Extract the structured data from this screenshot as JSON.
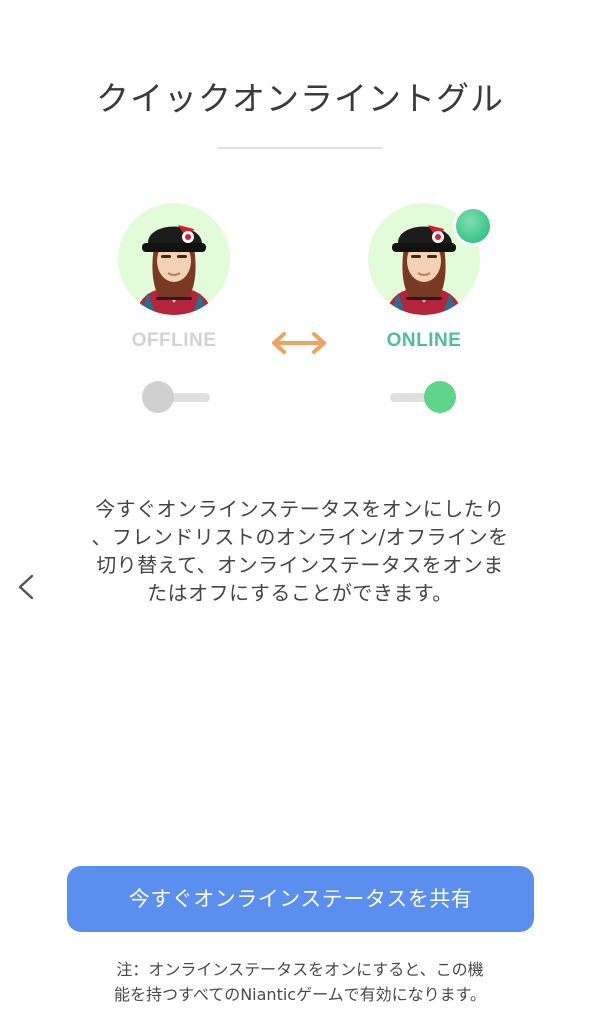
{
  "title": "クイックオンライントグル",
  "offline_card": {
    "label": "OFFLINE",
    "avatar_icon": "trainer-avatar-icon",
    "toggle_state": "off"
  },
  "online_card": {
    "label": "ONLINE",
    "avatar_icon": "trainer-avatar-icon",
    "toggle_state": "on",
    "status_dot_color": "#3ac48a"
  },
  "swap_icon": "double-arrow-icon",
  "back_icon": "chevron-left-icon",
  "description": "今すぐオンラインステータスをオンにしたり\n、フレンドリストのオンライン/オフラインを\n切り替えて、オンラインステータスをオンま\nたはオフにすることができます。",
  "share_button": {
    "label": "今すぐオンラインステータスを共有"
  },
  "note": "注：オンラインステータスをオンにすると、この機\n能を持つすべてのNianticゲームで有効になります。",
  "colors": {
    "accent_blue": "#5a8ff0",
    "online_green": "#4bbf99",
    "swap_orange": "#f0a35e",
    "avatar_bg": "#e2fbd9"
  }
}
